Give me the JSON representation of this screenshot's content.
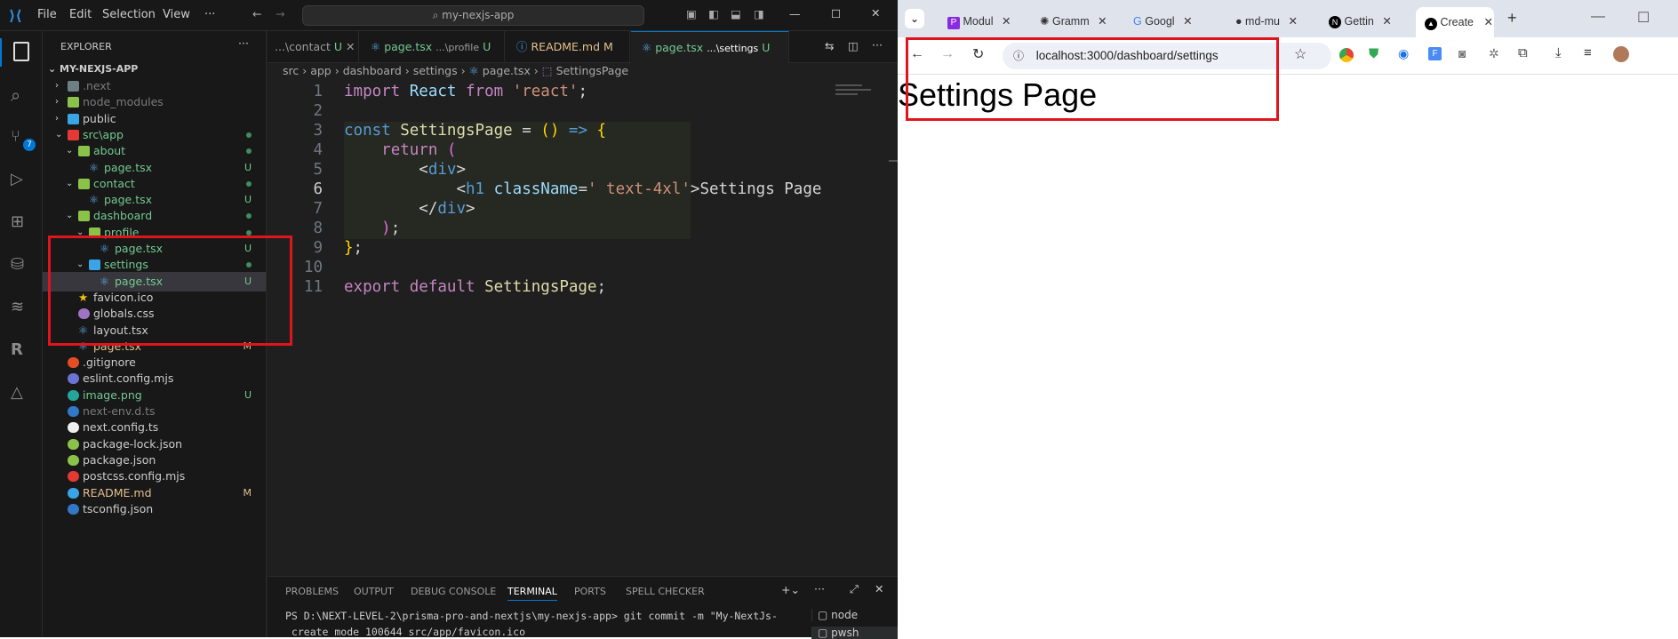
{
  "vscode": {
    "menu": [
      "File",
      "Edit",
      "Selection",
      "View",
      "···"
    ],
    "search_text": "my-nexjs-app",
    "explorer_title": "EXPLORER",
    "project": "MY-NEXJS-APP",
    "tree": [
      {
        "label": ".next",
        "status": ""
      },
      {
        "label": "node_modules",
        "status": ""
      },
      {
        "label": "public",
        "status": ""
      },
      {
        "label": "src\\app",
        "status": "dot"
      },
      {
        "label": "about",
        "status": "dot"
      },
      {
        "label": "page.tsx",
        "status": "U"
      },
      {
        "label": "contact",
        "status": "dot"
      },
      {
        "label": "page.tsx",
        "status": "U"
      },
      {
        "label": "dashboard",
        "status": "dot"
      },
      {
        "label": "profile",
        "status": "dot"
      },
      {
        "label": "page.tsx",
        "status": "U"
      },
      {
        "label": "settings",
        "status": "dot"
      },
      {
        "label": "page.tsx",
        "status": "U"
      },
      {
        "label": "favicon.ico",
        "status": ""
      },
      {
        "label": "globals.css",
        "status": ""
      },
      {
        "label": "layout.tsx",
        "status": ""
      },
      {
        "label": "page.tsx",
        "status": "M"
      },
      {
        "label": ".gitignore",
        "status": ""
      },
      {
        "label": "eslint.config.mjs",
        "status": ""
      },
      {
        "label": "image.png",
        "status": "U"
      },
      {
        "label": "next-env.d.ts",
        "status": ""
      },
      {
        "label": "next.config.ts",
        "status": ""
      },
      {
        "label": "package-lock.json",
        "status": ""
      },
      {
        "label": "package.json",
        "status": ""
      },
      {
        "label": "postcss.config.mjs",
        "status": ""
      },
      {
        "label": "README.md",
        "status": "M"
      },
      {
        "label": "tsconfig.json",
        "status": ""
      }
    ],
    "tabs": [
      {
        "label": "...\\contact",
        "status": "U"
      },
      {
        "label": "page.tsx",
        "hint": "...\\profile",
        "status": "U"
      },
      {
        "label": "README.md",
        "status": "M"
      },
      {
        "label": "page.tsx",
        "hint": "...\\settings",
        "status": "U"
      }
    ],
    "breadcrumb": [
      "src",
      "app",
      "dashboard",
      "settings",
      "page.tsx",
      "SettingsPage"
    ],
    "line_numbers": [
      "1",
      "2",
      "3",
      "4",
      "5",
      "6",
      "7",
      "8",
      "9",
      "10",
      "11"
    ],
    "panel_tabs": [
      "PROBLEMS",
      "OUTPUT",
      "DEBUG CONSOLE",
      "TERMINAL",
      "PORTS",
      "SPELL CHECKER"
    ],
    "terminal_line1": "PS D:\\NEXT-LEVEL-2\\prisma-pro-and-nextjs\\my-nexjs-app> git commit -m \"My-NextJs-",
    "terminal_line2": " create mode 100644 src/app/favicon.ico",
    "terminal_sessions": [
      "node",
      "pwsh"
    ],
    "scm_badge": "7"
  },
  "chrome": {
    "tabs": [
      "Modul",
      "Gramm",
      "Googl",
      "md-mu",
      "Gettin",
      "Create"
    ],
    "url": "localhost:3000/dashboard/settings",
    "page_heading": "Settings Page"
  }
}
